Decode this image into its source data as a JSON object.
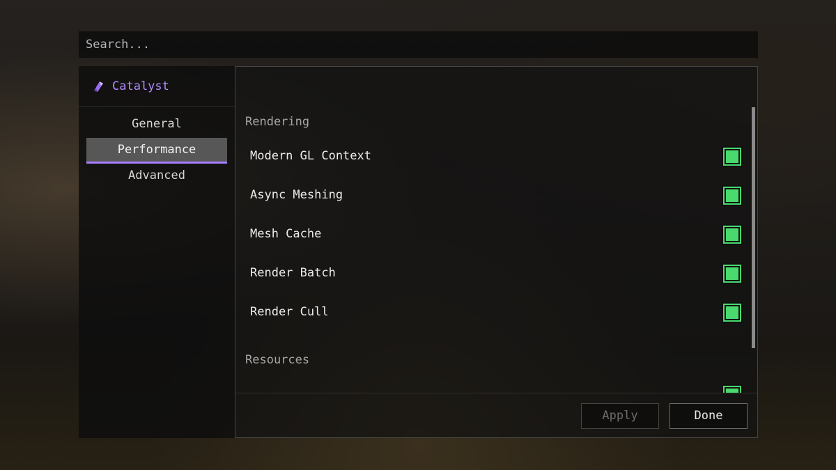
{
  "search": {
    "placeholder": "Search..."
  },
  "sidebar": {
    "mod_name": "Catalyst",
    "mod_icon": "amethyst-shard-icon",
    "items": [
      {
        "label": "General",
        "active": false
      },
      {
        "label": "Performance",
        "active": true
      },
      {
        "label": "Advanced",
        "active": false
      }
    ]
  },
  "content": {
    "sections": [
      {
        "title": "Rendering",
        "options": [
          {
            "label": "Modern GL Context",
            "enabled": true
          },
          {
            "label": "Async Meshing",
            "enabled": true
          },
          {
            "label": "Mesh Cache",
            "enabled": true
          },
          {
            "label": "Render Batch",
            "enabled": true
          },
          {
            "label": "Render Cull",
            "enabled": true
          }
        ]
      },
      {
        "title": "Resources",
        "options": []
      }
    ]
  },
  "footer": {
    "apply_label": "Apply",
    "done_label": "Done"
  },
  "colors": {
    "accent": "#a67cff",
    "mod_name": "#b48cff",
    "toggle_on": "#4ad96e"
  }
}
